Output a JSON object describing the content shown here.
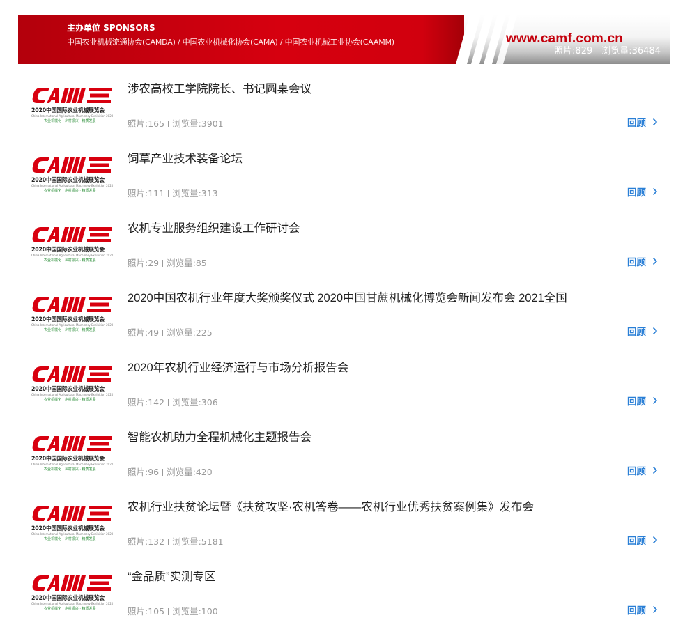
{
  "banner": {
    "sponsor_title": "主办单位 SPONSORS",
    "sponsor_orgs": "中国农业机械流通协会(CAMDA) / 中国农业机械化协会(CAMA) / 中国农业机械工业协会(CAAMM)",
    "site_url": "www.camf.com.cn",
    "photos_label": "照片:829",
    "views_label": "浏览量:36484",
    "brand_color": "#d6000f"
  },
  "logo": {
    "mark_text": "CAMF",
    "year_text": "2020中国国际农业机械展览会",
    "en_text": "China International Agricultural Machinery Exhibition 2020",
    "slogan_text": "农业机械化 · 乡村振兴 · 精质发展"
  },
  "items": [
    {
      "title": "涉农高校工学院院长、书记圆桌会议",
      "photos": "照片:165",
      "views": "浏览量:3901",
      "action": "回顾"
    },
    {
      "title": "饲草产业技术装备论坛",
      "photos": "照片:111",
      "views": "浏览量:313",
      "action": "回顾"
    },
    {
      "title": "农机专业服务组织建设工作研讨会",
      "photos": "照片:29",
      "views": "浏览量:85",
      "action": "回顾"
    },
    {
      "title": "2020中国农机行业年度大奖颁奖仪式 2020中国甘蔗机械化博览会新闻发布会 2021全国",
      "photos": "照片:49",
      "views": "浏览量:225",
      "action": "回顾"
    },
    {
      "title": "2020年农机行业经济运行与市场分析报告会",
      "photos": "照片:142",
      "views": "浏览量:306",
      "action": "回顾"
    },
    {
      "title": "智能农机助力全程机械化主题报告会",
      "photos": "照片:96",
      "views": "浏览量:420",
      "action": "回顾"
    },
    {
      "title": "农机行业扶贫论坛暨《扶贫攻坚·农机答卷——农机行业优秀扶贫案例集》发布会",
      "photos": "照片:132",
      "views": "浏览量:5181",
      "action": "回顾"
    },
    {
      "title": "“金品质”实测专区",
      "photos": "照片:105",
      "views": "浏览量:100",
      "action": "回顾"
    }
  ],
  "icons": {
    "review": "chevron-right-icon"
  },
  "colors": {
    "link": "#2a7fd6",
    "meta": "#9a9a9a",
    "logo_red": "#d8000f",
    "logo_green": "#2d8f3a"
  }
}
